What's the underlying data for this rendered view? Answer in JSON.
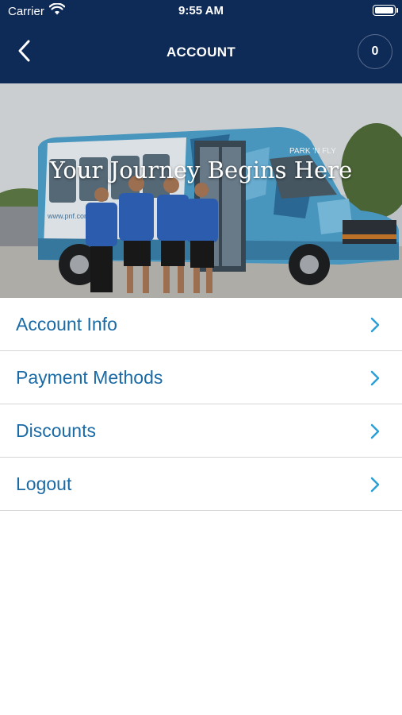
{
  "status_bar": {
    "carrier": "Carrier",
    "time": "9:55 AM"
  },
  "nav": {
    "title": "ACCOUNT",
    "cart_count": "0"
  },
  "hero": {
    "title": "Your Journey Begins Here",
    "bus_sign": "PARK 'N FLY",
    "bus_url": "www.pnf.com"
  },
  "menu": {
    "items": [
      {
        "label": "Account Info"
      },
      {
        "label": "Payment Methods"
      },
      {
        "label": "Discounts"
      },
      {
        "label": "Logout"
      }
    ]
  },
  "colors": {
    "header_bg": "#0e2a56",
    "menu_text": "#1a6aa6",
    "chevron": "#2b9fd6",
    "divider": "#d6d6d6"
  }
}
